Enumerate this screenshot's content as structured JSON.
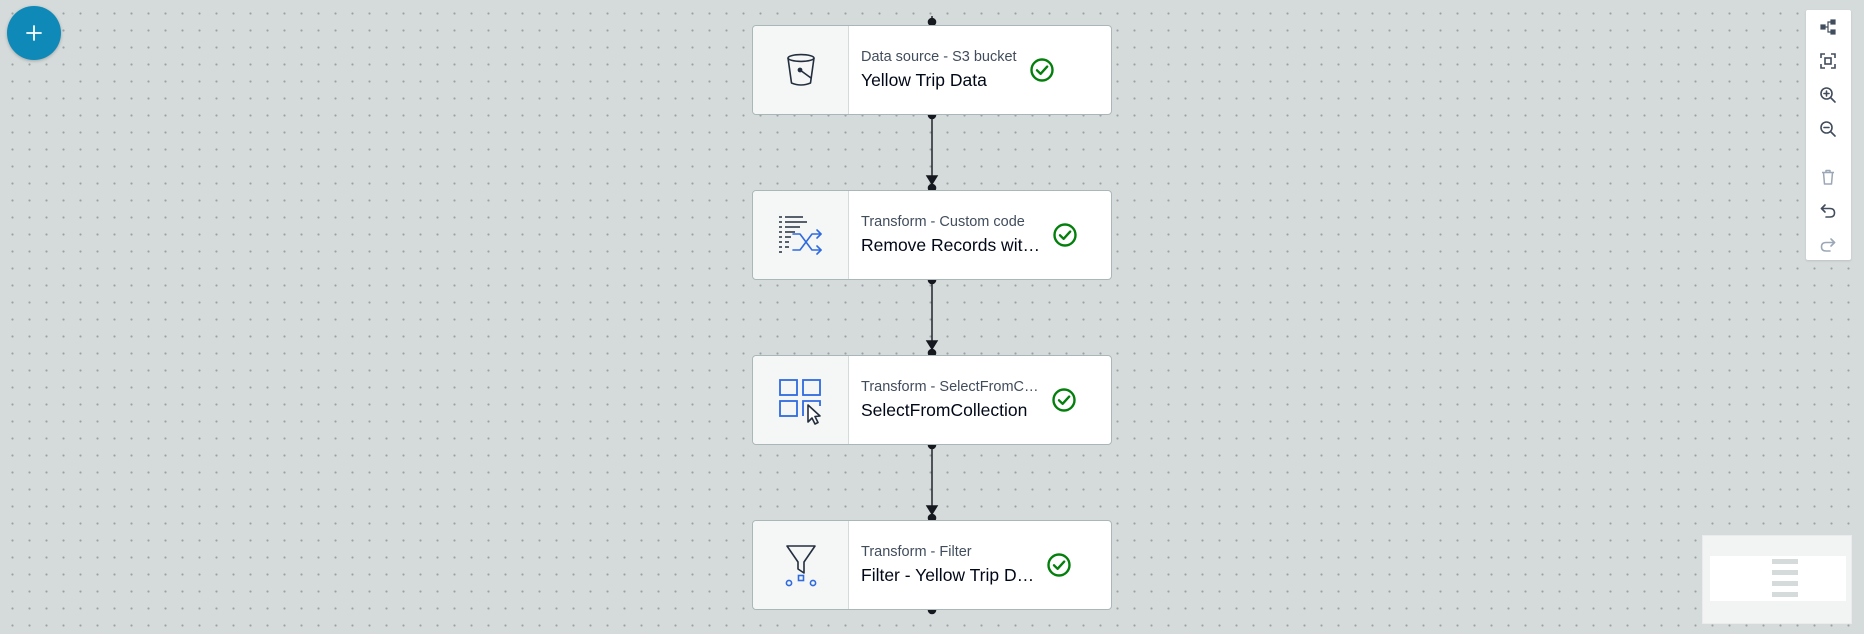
{
  "canvas": {
    "add_button_label": "+"
  },
  "nodes": [
    {
      "type_label": "Data source - S3 bucket",
      "name": "Yellow Trip Data",
      "icon": "bucket-icon",
      "status": "valid"
    },
    {
      "type_label": "Transform - Custom code",
      "name": "Remove Records wit…",
      "icon": "custom-code-icon",
      "status": "valid"
    },
    {
      "type_label": "Transform - SelectFromC…",
      "name": "SelectFromCollection",
      "icon": "select-from-collection-icon",
      "status": "valid"
    },
    {
      "type_label": "Transform - Filter",
      "name": "Filter - Yellow Trip D…",
      "icon": "filter-icon",
      "status": "valid"
    }
  ],
  "toolbar": {
    "tools": [
      {
        "name": "layout-icon",
        "enabled": true
      },
      {
        "name": "fit-view-icon",
        "enabled": true
      },
      {
        "name": "zoom-in-icon",
        "enabled": true
      },
      {
        "name": "zoom-out-icon",
        "enabled": true
      },
      {
        "name": "delete-icon",
        "enabled": false
      },
      {
        "name": "undo-icon",
        "enabled": true
      },
      {
        "name": "redo-icon",
        "enabled": false
      }
    ]
  },
  "colors": {
    "canvas_background": "#d5dbdb",
    "add_button": "#0f8ab8",
    "status_success": "#037f0c",
    "icon_blue": "#2f6be0",
    "icon_dark": "#232f3e",
    "connector": "#16191f"
  }
}
